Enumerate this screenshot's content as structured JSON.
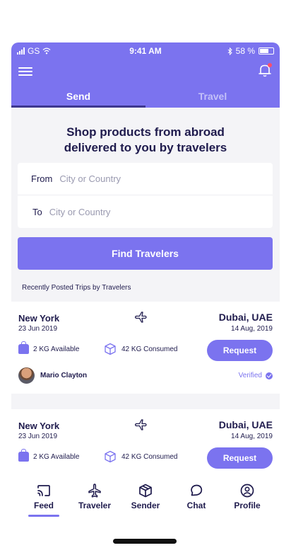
{
  "status_bar": {
    "carrier": "GS",
    "time": "9:41 AM",
    "battery": "58 %"
  },
  "tabs": [
    {
      "label": "Send",
      "active": true
    },
    {
      "label": "Travel",
      "active": false
    }
  ],
  "headline": "Shop products from abroad delivered to you by travelers",
  "form": {
    "from_label": "From",
    "from_placeholder": "City or Country",
    "to_label": "To",
    "to_placeholder": "City or Country"
  },
  "find_button": "Find Travelers",
  "recent_heading": "Recently Posted Trips by Travelers",
  "trips": [
    {
      "from_city": "New York",
      "from_date": "23 Jun  2019",
      "to_city": "Dubai, UAE",
      "to_date": "14 Aug, 2019",
      "available": "2 KG Available",
      "consumed": "42 KG Consumed",
      "request_label": "Request",
      "traveler": "Mario Clayton",
      "verified": "Verified"
    },
    {
      "from_city": "New York",
      "from_date": "23 Jun  2019",
      "to_city": "Dubai, UAE",
      "to_date": "14 Aug, 2019",
      "available": "2 KG Available",
      "consumed": "42 KG Consumed",
      "request_label": "Request"
    }
  ],
  "nav": [
    {
      "label": "Feed",
      "icon": "cast-feed-icon",
      "active": true
    },
    {
      "label": "Traveler",
      "icon": "plane-icon",
      "active": false
    },
    {
      "label": "Sender",
      "icon": "box-icon",
      "active": false
    },
    {
      "label": "Chat",
      "icon": "chat-bubble-icon",
      "active": false
    },
    {
      "label": "Profile",
      "icon": "user-circle-icon",
      "active": false
    }
  ],
  "colors": {
    "primary": "#7b73ef",
    "text": "#1f1b4d",
    "background": "#f4f4f7",
    "notification_dot": "#ff4d6a"
  }
}
